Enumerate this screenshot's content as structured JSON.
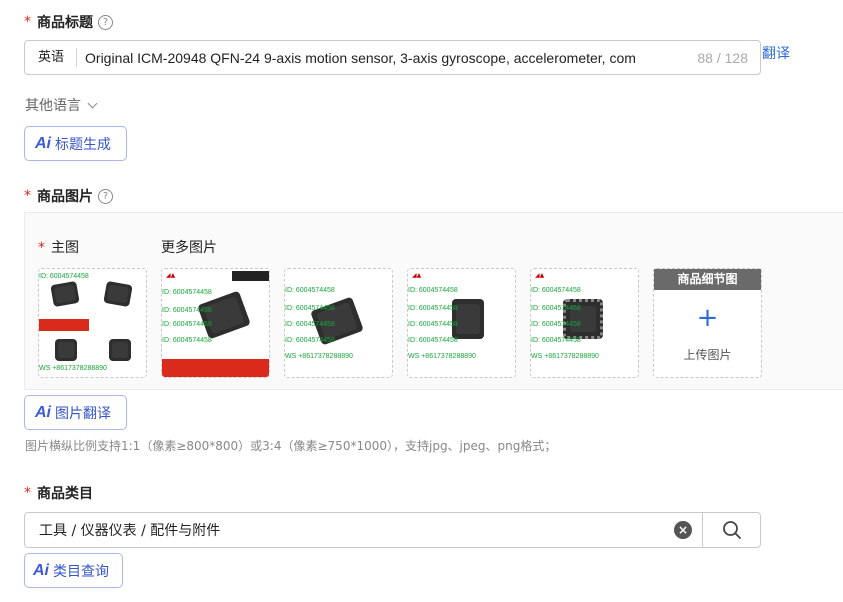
{
  "title_section": {
    "label": "商品标题",
    "lang": "英语",
    "value": "Original ICM-20948 QFN-24 9-axis motion sensor, 3-axis gyroscope, accelerometer, com",
    "counter": "88 / 128",
    "translate_link": "翻译",
    "other_lang": "其他语言",
    "ai_button": "标题生成"
  },
  "images_section": {
    "label": "商品图片",
    "main_label": "主图",
    "more_label": "更多图片",
    "watermark_id": "ID: 6004574458",
    "watermark_ws": "WS +8617378288890",
    "upload_card_title": "商品细节图",
    "upload_card_plus": "+",
    "upload_card_text": "上传图片",
    "ai_button": "图片翻译",
    "hint": "图片横纵比例支持1:1（像素≥800*800）或3:4（像素≥750*1000），支持jpg、jpeg、png格式；"
  },
  "category_section": {
    "label": "商品类目",
    "value": "工具 / 仪器仪表 / 配件与附件",
    "ai_button": "类目查询"
  },
  "icons": {
    "ai": "Ai",
    "help": "?",
    "clear": "×"
  },
  "colors": {
    "required": "#e1251b",
    "link": "#2d6bd7",
    "watermark": "#18a53b"
  }
}
